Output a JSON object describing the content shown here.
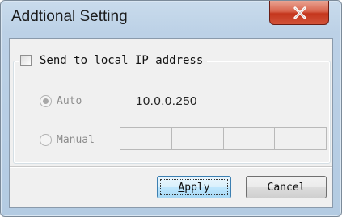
{
  "window": {
    "title": "Addtional Setting"
  },
  "group": {
    "checkbox_label": "Send to local IP address",
    "checked": false
  },
  "options": {
    "auto_label": "Auto",
    "auto_value": "10.0.0.250",
    "manual_label": "Manual",
    "selected": "Auto"
  },
  "buttons": {
    "apply_label": "Apply",
    "cancel_label": "Cancel"
  },
  "icons": {
    "close": "close-icon"
  }
}
